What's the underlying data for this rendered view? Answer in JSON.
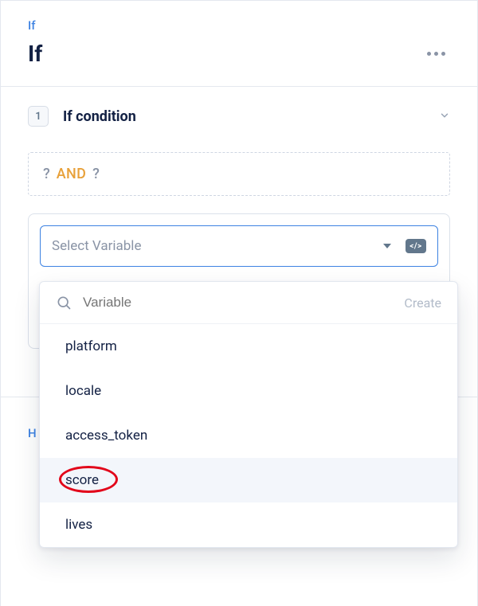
{
  "header": {
    "breadcrumb": "If",
    "title": "If"
  },
  "section": {
    "index": "1",
    "title": "If condition"
  },
  "expression": {
    "left": "?",
    "op": "AND",
    "right": "?"
  },
  "select": {
    "placeholder": "Select Variable",
    "code_toggle": "</>"
  },
  "dropdown": {
    "search_placeholder": "Variable",
    "create_label": "Create",
    "items": [
      "platform",
      "locale",
      "access_token",
      "score",
      "lives"
    ],
    "hover_index": 3,
    "highlight_index": 3
  },
  "side_label": "H"
}
